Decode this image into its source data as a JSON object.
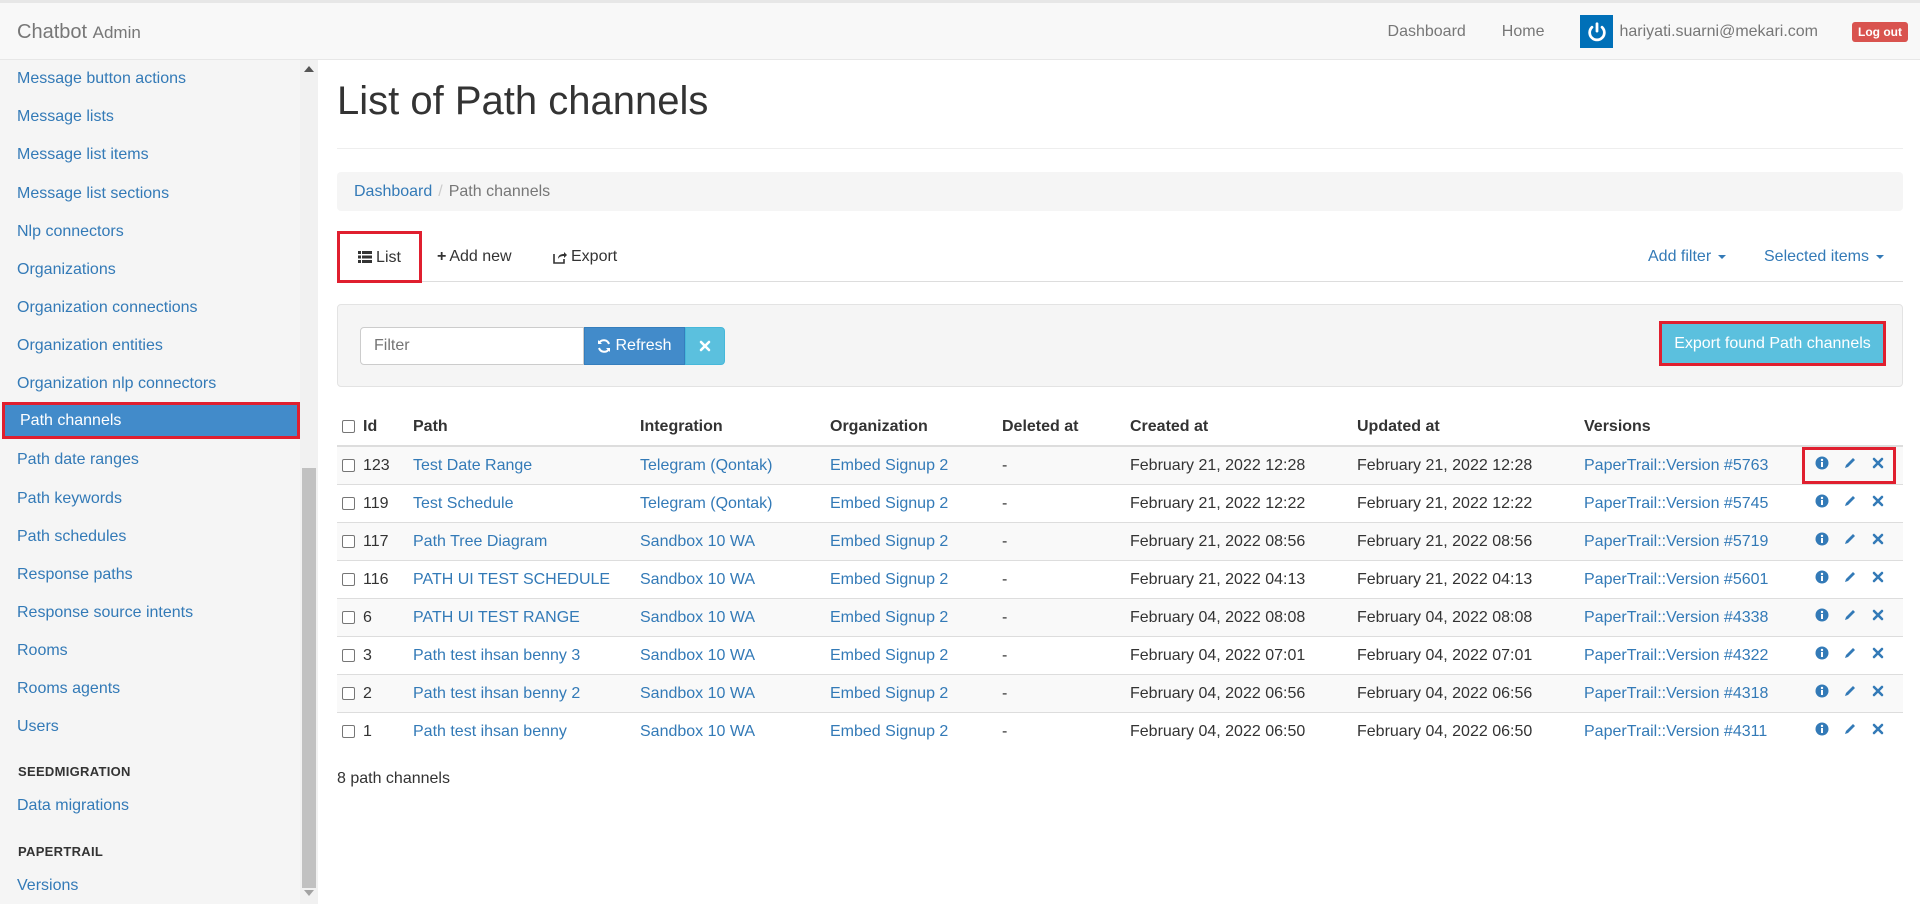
{
  "navbar": {
    "brand": "Chatbot",
    "brand_sub": "Admin",
    "links": [
      "Dashboard",
      "Home"
    ],
    "user_email": "hariyati.suarni@mekari.com",
    "logout_label": "Log out"
  },
  "sidebar": {
    "items": [
      {
        "label": "Message button actions"
      },
      {
        "label": "Message lists"
      },
      {
        "label": "Message list items"
      },
      {
        "label": "Message list sections"
      },
      {
        "label": "Nlp connectors"
      },
      {
        "label": "Organizations"
      },
      {
        "label": "Organization connections"
      },
      {
        "label": "Organization entities"
      },
      {
        "label": "Organization nlp connectors"
      },
      {
        "label": "Path channels"
      },
      {
        "label": "Path date ranges"
      },
      {
        "label": "Path keywords"
      },
      {
        "label": "Path schedules"
      },
      {
        "label": "Response paths"
      },
      {
        "label": "Response source intents"
      },
      {
        "label": "Rooms"
      },
      {
        "label": "Rooms agents"
      },
      {
        "label": "Users"
      }
    ],
    "active_index": 9,
    "sections": [
      {
        "header": "SEEDMIGRATION",
        "items": [
          "Data migrations"
        ]
      },
      {
        "header": "PAPERTRAIL",
        "items": [
          "Versions"
        ]
      }
    ]
  },
  "page": {
    "title": "List of Path channels",
    "breadcrumb": {
      "root": "Dashboard",
      "current": "Path channels"
    }
  },
  "tabs": {
    "list": "List",
    "add_new": "Add new",
    "export": "Export",
    "add_filter": "Add filter",
    "selected_items": "Selected items"
  },
  "filter": {
    "placeholder": "Filter",
    "refresh": "Refresh",
    "export_found": "Export found Path channels"
  },
  "table": {
    "columns": [
      "Id",
      "Path",
      "Integration",
      "Organization",
      "Deleted at",
      "Created at",
      "Updated at",
      "Versions"
    ],
    "rows": [
      {
        "id": "123",
        "path": "Test Date Range",
        "integration": "Telegram (Qontak)",
        "organization": "Embed Signup 2",
        "deleted_at": "-",
        "created_at": "February 21, 2022 12:28",
        "updated_at": "February 21, 2022 12:28",
        "version": "PaperTrail::Version #5763"
      },
      {
        "id": "119",
        "path": "Test Schedule",
        "integration": "Telegram (Qontak)",
        "organization": "Embed Signup 2",
        "deleted_at": "-",
        "created_at": "February 21, 2022 12:22",
        "updated_at": "February 21, 2022 12:22",
        "version": "PaperTrail::Version #5745"
      },
      {
        "id": "117",
        "path": "Path Tree Diagram",
        "integration": "Sandbox 10 WA",
        "organization": "Embed Signup 2",
        "deleted_at": "-",
        "created_at": "February 21, 2022 08:56",
        "updated_at": "February 21, 2022 08:56",
        "version": "PaperTrail::Version #5719"
      },
      {
        "id": "116",
        "path": "PATH UI TEST SCHEDULE",
        "integration": "Sandbox 10 WA",
        "organization": "Embed Signup 2",
        "deleted_at": "-",
        "created_at": "February 21, 2022 04:13",
        "updated_at": "February 21, 2022 04:13",
        "version": "PaperTrail::Version #5601"
      },
      {
        "id": "6",
        "path": "PATH UI TEST RANGE",
        "integration": "Sandbox 10 WA",
        "organization": "Embed Signup 2",
        "deleted_at": "-",
        "created_at": "February 04, 2022 08:08",
        "updated_at": "February 04, 2022 08:08",
        "version": "PaperTrail::Version #4338"
      },
      {
        "id": "3",
        "path": "Path test ihsan benny 3",
        "integration": "Sandbox 10 WA",
        "organization": "Embed Signup 2",
        "deleted_at": "-",
        "created_at": "February 04, 2022 07:01",
        "updated_at": "February 04, 2022 07:01",
        "version": "PaperTrail::Version #4322"
      },
      {
        "id": "2",
        "path": "Path test ihsan benny 2",
        "integration": "Sandbox 10 WA",
        "organization": "Embed Signup 2",
        "deleted_at": "-",
        "created_at": "February 04, 2022 06:56",
        "updated_at": "February 04, 2022 06:56",
        "version": "PaperTrail::Version #4318"
      },
      {
        "id": "1",
        "path": "Path test ihsan benny",
        "integration": "Sandbox 10 WA",
        "organization": "Embed Signup 2",
        "deleted_at": "-",
        "created_at": "February 04, 2022 06:50",
        "updated_at": "February 04, 2022 06:50",
        "version": "PaperTrail::Version #4311"
      }
    ]
  },
  "footer": {
    "count": "8 path channels"
  },
  "colors": {
    "link": "#337ab7",
    "active": "#428bca",
    "info": "#5bc0de",
    "danger": "#d9534f",
    "highlight": "#e01f2f"
  }
}
